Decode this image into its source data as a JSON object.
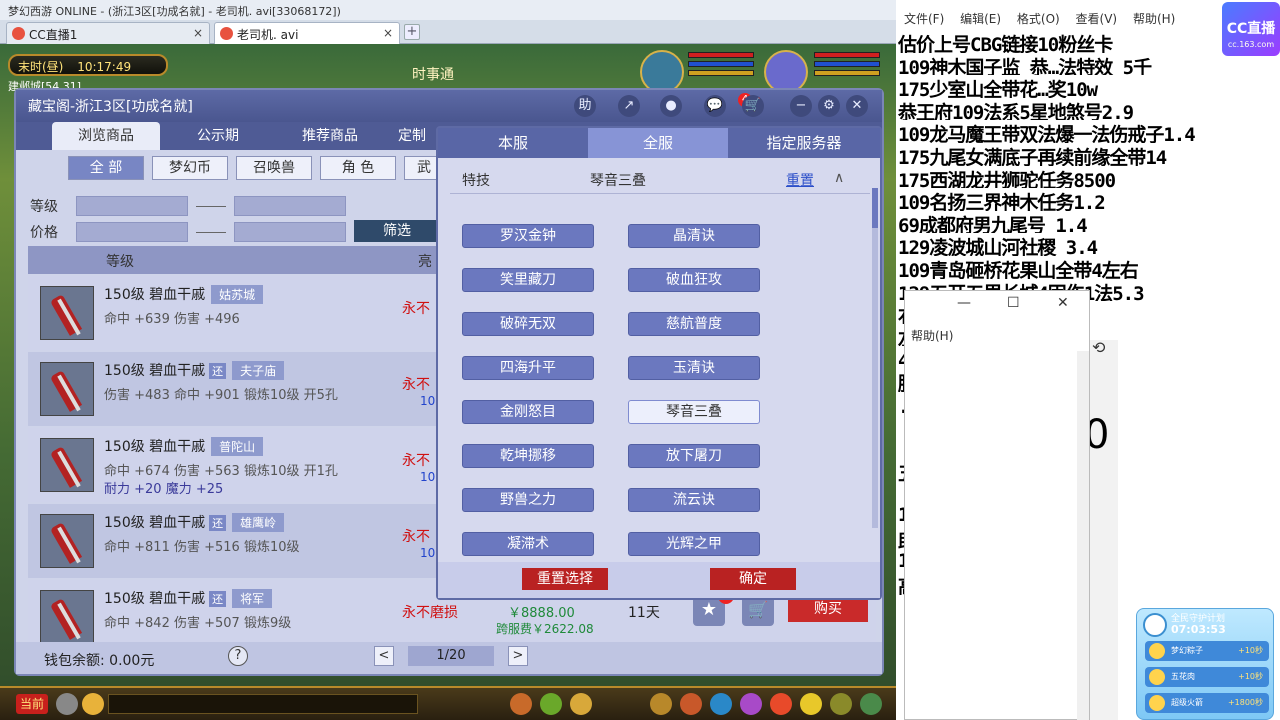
{
  "browser": {
    "window_title": "梦幻西游 ONLINE - (浙江3区[功成名就] - 老司机. avi[33068172])",
    "tabs": [
      {
        "label": "CC直播1",
        "close": "×"
      },
      {
        "label": "老司机. avi",
        "close": "×"
      }
    ],
    "new_tab": "+"
  },
  "hud": {
    "time_label": "末时(昼)",
    "clock": "10:17:49",
    "location": "建邺城[54,31]",
    "banner": "时事通"
  },
  "cbg": {
    "title": "藏宝阁-浙江3区[功成名就]",
    "header_icons": [
      "助",
      "↗",
      "●",
      "💬",
      "🛒"
    ],
    "mail_badge": "4",
    "window_controls": [
      "−",
      "⚙",
      "✕"
    ],
    "tabs": [
      "浏览商品",
      "公示期",
      "推荐商品",
      "定制"
    ],
    "categories": [
      "全 部",
      "梦幻币",
      "召唤兽",
      "角 色",
      "武"
    ],
    "level_label": "等级",
    "price_label": "价格",
    "filter_button": "筛选",
    "list_header_level": "等级",
    "list_header_light": "亮",
    "items": [
      {
        "name": "150级 碧血干戚",
        "tag": "",
        "server": "姑苏城",
        "stat1": "命中 +639 伤害 +496",
        "stat2": "",
        "perm": "永不",
        "perm_sub": ""
      },
      {
        "name": "150级 碧血干戚",
        "tag": "还",
        "server": "夫子庙",
        "stat1": "伤害 +483 命中 +901 锻炼10级 开5孔",
        "stat2": "",
        "perm": "永不",
        "perm_sub": "10"
      },
      {
        "name": "150级 碧血干戚",
        "tag": "",
        "server": "普陀山",
        "stat1": "命中 +674 伤害 +563 锻炼10级 开1孔",
        "stat2": "耐力 +20 魔力 +25",
        "perm": "永不",
        "perm_sub": "10"
      },
      {
        "name": "150级 碧血干戚",
        "tag": "还",
        "server": "雄鹰岭",
        "stat1": "命中 +811 伤害 +516 锻炼10级",
        "stat2": "",
        "perm": "永不",
        "perm_sub": "10"
      },
      {
        "name": "150级 碧血干戚",
        "tag": "还",
        "server": "将军",
        "stat1": "命中 +842 伤害 +507 锻炼9级",
        "stat2": "",
        "perm": "永不磨损",
        "perm_sub": "",
        "price": "￥8888.00",
        "fee": "跨服费￥2622.08",
        "days": "11天",
        "star_badge": "12",
        "buy": "购买"
      }
    ],
    "wallet": "钱包余额: 0.00元",
    "help": "?",
    "prev": "<",
    "next": ">",
    "page": "1/20"
  },
  "popup": {
    "tabs": [
      "本服",
      "全服",
      "指定服务器"
    ],
    "active_tab": "全服",
    "row_label": "特技",
    "row_value": "琴音三叠",
    "reset_link": "重置",
    "collapse": "∧",
    "skills": [
      "罗汉金钟",
      "晶清诀",
      "笑里藏刀",
      "破血狂攻",
      "破碎无双",
      "慈航普度",
      "四海升平",
      "玉清诀",
      "金刚怒目",
      "琴音三叠",
      "乾坤挪移",
      "放下屠刀",
      "野兽之力",
      "流云诀",
      "凝滞术",
      "光辉之甲"
    ],
    "selected_skill": "琴音三叠",
    "reset_button": "重置选择",
    "confirm_button": "确定"
  },
  "toolbar": {
    "now_label": "当前"
  },
  "notepad": {
    "menu": [
      "文件(F)",
      "编辑(E)",
      "格式(O)",
      "查看(V)",
      "帮助(H)"
    ],
    "lines": [
      "估价上号CBG链接10粉丝卡",
      "109神木国子监 恭…法特效 5千",
      "175少室山全带花…奖10w",
      "恭王府109法系5星地煞号2.9",
      "109龙马魔王带双法爆一法伤戒子1.4",
      "175九尾女满底子再续前缘全带14",
      "175西湖龙井狮驼任务8500",
      "109名扬三界神木任务1.2",
      "69成都府男九尾号  1.4",
      "129凌波城山河社稷  3.4",
      "109青岛砸桥花果山全带4左右",
      "129五开五里长城4固伤1法5.3",
      "                                右",
      "                                左右",
      "                               4不带宝宝",
      "                               膀子锦衣",
      "                               .5高端",
      "",
      "",
      "                                五开单开都适合",
      "",
      "                               11.5",
      "                               助1.1",
      "                               1",
      "                               高端"
    ],
    "small_window_menu": "帮助(H)",
    "small_window_controls": [
      "—",
      "☐",
      "✕"
    ],
    "zero": "0",
    "history_icon": "⟲"
  },
  "cc_logo": {
    "main": "CC直播",
    "sub": "cc.163.com"
  },
  "widget": {
    "title": "全民守护计划",
    "time": "07:03:53",
    "items": [
      {
        "label": "梦幻粽子",
        "points": "+10秒"
      },
      {
        "label": "五花肉",
        "points": "+10秒"
      },
      {
        "label": "超级火箭",
        "points": "+1800秒"
      }
    ]
  },
  "colors": {
    "cbg_header": "#5d6aa6",
    "buy_red": "#c92a2a",
    "price_green": "#1f8a3a",
    "perm_red": "#d01010"
  }
}
